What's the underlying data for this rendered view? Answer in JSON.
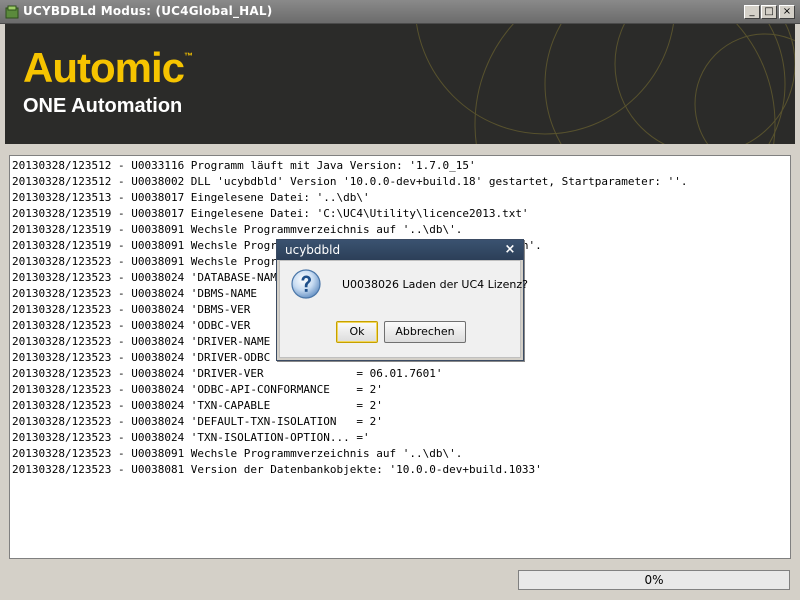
{
  "window": {
    "title": "UCYBDBLd Modus:  (UC4Global_HAL)",
    "min_glyph": "_",
    "max_glyph": "□",
    "close_glyph": "×"
  },
  "banner": {
    "brand": "Automic",
    "brand_tm": "™",
    "subtitle": "ONE Automation",
    "brand_color": "#f6c400",
    "background": "#2b2b29"
  },
  "log": {
    "lines": [
      "20130328/123512 - U0033116 Programm läuft mit Java Version: '1.7.0_15'",
      "20130328/123512 - U0038002 DLL 'ucybdbld' Version '10.0.0-dev+build.18' gestartet, Startparameter: ''.",
      "20130328/123513 - U0038017 Eingelesene Datei: '..\\db\\'",
      "20130328/123519 - U0038017 Eingelesene Datei: 'C:\\UC4\\Utility\\licence2013.txt'",
      "20130328/123519 - U0038091 Wechsle Programmverzeichnis auf '..\\db\\'.",
      "20130328/123519 - U0038091 Wechsle Programmverzeichnis auf 'C:\\UC4\\Utility\\bin'.",
      "20130328/123523 - U0038091 Wechsle Programmverzeichnis auf '..\\db\\'.",
      "20130328/123523 - U0038024 'DATABASE-NAME',",
      "20130328/123523 - U0038024 'DBMS-NAME                        '",
      "20130328/123523 - U0038024 'DBMS-VER",
      "20130328/123523 - U0038024 'ODBC-VER",
      "20130328/123523 - U0038024 'DRIVER-NAME",
      "20130328/123523 - U0038024 'DRIVER-ODBC",
      "20130328/123523 - U0038024 'DRIVER-VER              = 06.01.7601'",
      "20130328/123523 - U0038024 'ODBC-API-CONFORMANCE    = 2'",
      "20130328/123523 - U0038024 'TXN-CAPABLE             = 2'",
      "20130328/123523 - U0038024 'DEFAULT-TXN-ISOLATION   = 2'",
      "20130328/123523 - U0038024 'TXN-ISOLATION-OPTION... ='",
      "20130328/123523 - U0038091 Wechsle Programmverzeichnis auf '..\\db\\'.",
      "20130328/123523 - U0038081 Version der Datenbankobjekte: '10.0.0-dev+build.1033'"
    ]
  },
  "progress": {
    "label": "0%",
    "fraction": 0.0
  },
  "dialog": {
    "title": "ucybdbld",
    "close_glyph": "×",
    "message": "U0038026 Laden der UC4 Lizenz?",
    "ok_label": "Ok",
    "cancel_label": "Abbrechen",
    "icon": "question-icon"
  }
}
